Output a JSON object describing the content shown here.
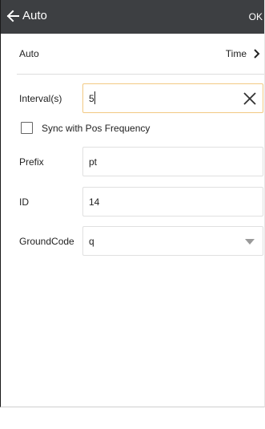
{
  "appbar": {
    "title": "Auto",
    "ok_label": "OK",
    "back_icon": "arrow-left-icon"
  },
  "mode_row": {
    "label": "Auto",
    "value": "Time",
    "icon": "chevron-right-icon"
  },
  "interval": {
    "label": "Interval(s)",
    "value": "5",
    "clear_icon": "close-icon"
  },
  "sync": {
    "label": "Sync with Pos Frequency",
    "checked": false
  },
  "prefix": {
    "label": "Prefix",
    "value": "pt"
  },
  "id_field": {
    "label": "ID",
    "value": "14"
  },
  "ground_code": {
    "label": "GroundCode",
    "value": "q",
    "icon": "chevron-down-icon"
  },
  "colors": {
    "appbar_bg": "#3d3f42",
    "focus_border": "#f2c983",
    "field_border": "#e0e0e0"
  }
}
